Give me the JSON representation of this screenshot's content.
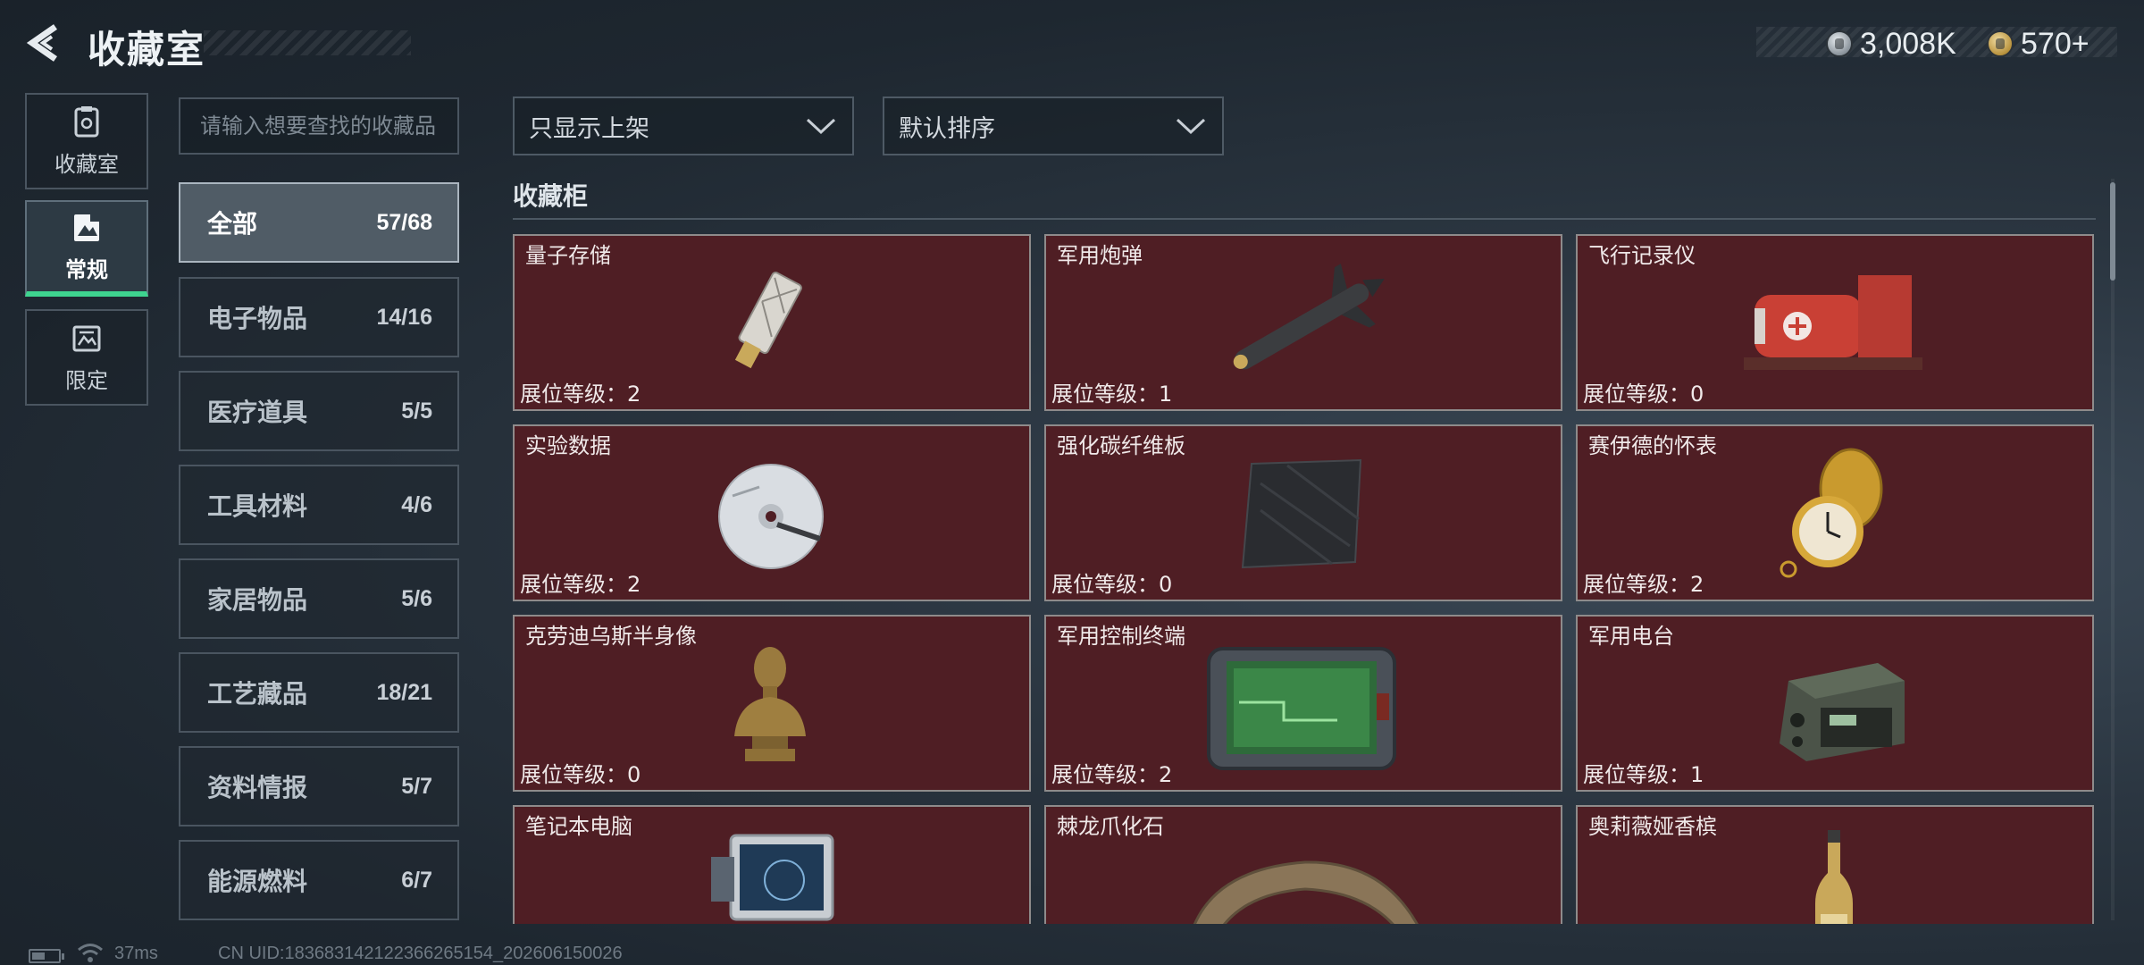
{
  "header": {
    "title": "收藏室",
    "currencies": [
      {
        "icon": "silver-coin-icon",
        "value": "3,008K"
      },
      {
        "icon": "gold-coin-icon",
        "value": "570+"
      }
    ]
  },
  "left_tabs": [
    {
      "label": "收藏室",
      "icon": "collection-room-icon",
      "active": false
    },
    {
      "label": "常规",
      "icon": "regular-icon",
      "active": true
    },
    {
      "label": "限定",
      "icon": "limited-icon",
      "active": false
    }
  ],
  "search": {
    "placeholder": "请输入想要查找的收藏品"
  },
  "categories": [
    {
      "name": "全部",
      "count": "57/68",
      "active": true
    },
    {
      "name": "电子物品",
      "count": "14/16"
    },
    {
      "name": "医疗道具",
      "count": "5/5"
    },
    {
      "name": "工具材料",
      "count": "4/6"
    },
    {
      "name": "家居物品",
      "count": "5/6"
    },
    {
      "name": "工艺藏品",
      "count": "18/21"
    },
    {
      "name": "资料情报",
      "count": "5/7"
    },
    {
      "name": "能源燃料",
      "count": "6/7"
    }
  ],
  "filters": {
    "show_filter": "只显示上架",
    "sort": "默认排序"
  },
  "section_title": "收藏柜",
  "items": [
    {
      "name": "量子存储",
      "level": "展位等级：2",
      "icon": "usb-drive-icon"
    },
    {
      "name": "军用炮弹",
      "level": "展位等级：1",
      "icon": "missile-icon"
    },
    {
      "name": "飞行记录仪",
      "level": "展位等级：0",
      "icon": "flight-recorder-icon"
    },
    {
      "name": "实验数据",
      "level": "展位等级：2",
      "icon": "disc-icon"
    },
    {
      "name": "强化碳纤维板",
      "level": "展位等级：0",
      "icon": "carbon-plate-icon"
    },
    {
      "name": "赛伊德的怀表",
      "level": "展位等级：2",
      "icon": "pocket-watch-icon"
    },
    {
      "name": "克劳迪乌斯半身像",
      "level": "展位等级：0",
      "icon": "bust-icon"
    },
    {
      "name": "军用控制终端",
      "level": "展位等级：2",
      "icon": "control-terminal-icon"
    },
    {
      "name": "军用电台",
      "level": "展位等级：1",
      "icon": "radio-icon"
    },
    {
      "name": "笔记本电脑",
      "level": "",
      "icon": "laptop-icon"
    },
    {
      "name": "棘龙爪化石",
      "level": "",
      "icon": "claw-fossil-icon"
    },
    {
      "name": "奥莉薇娅香槟",
      "level": "",
      "icon": "champagne-icon"
    }
  ],
  "status_bar": {
    "ping": "37ms",
    "uid": "CN UID:183683142122366265154_202606150026"
  }
}
